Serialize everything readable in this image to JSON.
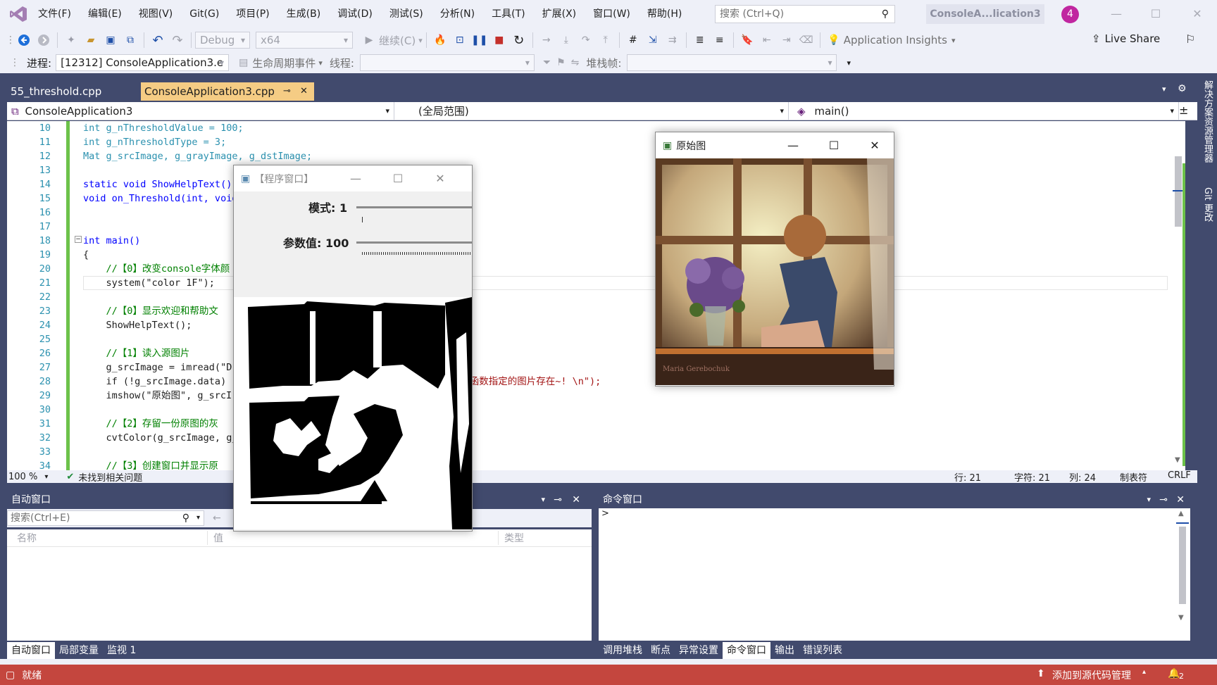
{
  "menu": [
    "文件(F)",
    "编辑(E)",
    "视图(V)",
    "Git(G)",
    "项目(P)",
    "生成(B)",
    "调试(D)",
    "测试(S)",
    "分析(N)",
    "工具(T)",
    "扩展(X)",
    "窗口(W)",
    "帮助(H)"
  ],
  "search": {
    "placeholder": "搜索 (Ctrl+Q)"
  },
  "title_badge": "ConsoleA...lication3",
  "user_badge": "4",
  "toolbar": {
    "config": "Debug",
    "platform": "x64",
    "continue_label": "继续(C)",
    "app_insights": "Application Insights",
    "live_share": "Live Share"
  },
  "toolbar2": {
    "process_label": "进程:",
    "process_value": "[12312] ConsoleApplication3.e",
    "lifecycle_label": "生命周期事件",
    "thread_label": "线程:",
    "stack_label": "堆栈帧:"
  },
  "tabs": [
    {
      "label": "55_threshold.cpp"
    },
    {
      "label": "ConsoleApplication3.cpp"
    }
  ],
  "navbar": {
    "project": "ConsoleApplication3",
    "scope": "(全局范围)",
    "member": "main()"
  },
  "side_tabs": [
    "解决方案资源管理器",
    "Git 更改"
  ],
  "line_numbers": [
    "10",
    "11",
    "12",
    "13",
    "14",
    "15",
    "16",
    "17",
    "18",
    "19",
    "20",
    "21",
    "22",
    "23",
    "24",
    "25",
    "26",
    "27",
    "28",
    "29",
    "30",
    "31",
    "32",
    "33",
    "34"
  ],
  "code": {
    "l10": "int g_nThresholdValue = 100;",
    "l11": "int g_nThresholdType = 3;",
    "l12": "Mat g_srcImage, g_grayImage, g_dstImage;",
    "l14": "static void ShowHelpText();",
    "l15": "void on_Threshold(int, void",
    "l18": "int main()",
    "l19": "{",
    "l20": "    //【0】改变console字体颜",
    "l21": "    system(\"color 1F\");",
    "l23": "    //【0】显示欢迎和帮助文",
    "l24": "    ShowHelpText();",
    "l26": "    //【1】读入源图片",
    "l27": "    g_srcImage = imread(\"D:",
    "l28a": "    if (!g_srcImage.data) ",
    "l28b": "imread函数指定的图片存在~! \\n\");",
    "l29": "    imshow(\"原始图\", g_srcI",
    "l31": "    //【2】存留一份原图的灰",
    "l32": "    cvtColor(g_srcImage, g_",
    "l34": "    //【3】创建窗口并显示原"
  },
  "editor_status": {
    "zoom": "100 %",
    "issues": "未找到相关问题",
    "line": "行: 21",
    "char": "字符: 21",
    "col": "列: 24",
    "tabs": "制表符",
    "eol": "CRLF"
  },
  "auto_window": {
    "title": "自动窗口",
    "search_placeholder": "搜索(Ctrl+E)",
    "columns": [
      "名称",
      "值",
      "类型"
    ],
    "tabs": [
      "自动窗口",
      "局部变量",
      "监视 1"
    ]
  },
  "cmd_window": {
    "title": "命令窗口",
    "prompt": ">",
    "tabs": [
      "调用堆栈",
      "断点",
      "异常设置",
      "命令窗口",
      "输出",
      "错误列表"
    ]
  },
  "statusbar": {
    "ready": "就绪",
    "source_control": "添加到源代码管理",
    "notifications": "2"
  },
  "prog_window": {
    "title": "【程序窗口】",
    "mode_label": "模式: 1",
    "mode_value": 1,
    "param_label": "参数值: 100",
    "param_value": 100
  },
  "orig_window": {
    "title": "原始图",
    "watermark": "Maria Gerebochuk"
  },
  "colors": {
    "accent_tab": "#f5cc84",
    "statusbar": "#c4463e",
    "frame": "#414a6d",
    "user_badge": "#c026a0"
  }
}
